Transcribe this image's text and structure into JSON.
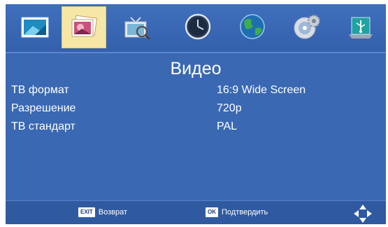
{
  "tabs": [
    {
      "icon": "picture-icon",
      "active": false
    },
    {
      "icon": "photo-icon",
      "active": true
    },
    {
      "icon": "tv-search-icon",
      "active": false
    },
    {
      "icon": "clock-icon",
      "active": false
    },
    {
      "icon": "globe-icon",
      "active": false
    },
    {
      "icon": "disc-settings-icon",
      "active": false
    },
    {
      "icon": "usb-icon",
      "active": false
    }
  ],
  "page_title": "Видео",
  "settings": [
    {
      "label": "ТВ формат",
      "value": "16:9 Wide Screen"
    },
    {
      "label": "Разрешение",
      "value": "720p"
    },
    {
      "label": "ТВ стандарт",
      "value": "PAL"
    }
  ],
  "footer": {
    "exit_key": "EXIT",
    "exit_label": "Возврат",
    "ok_key": "OK",
    "ok_label": "Подтвердить"
  },
  "colors": {
    "background": "#3a68b3",
    "active_tab": "#f6e7a6",
    "text": "#ffffff"
  }
}
